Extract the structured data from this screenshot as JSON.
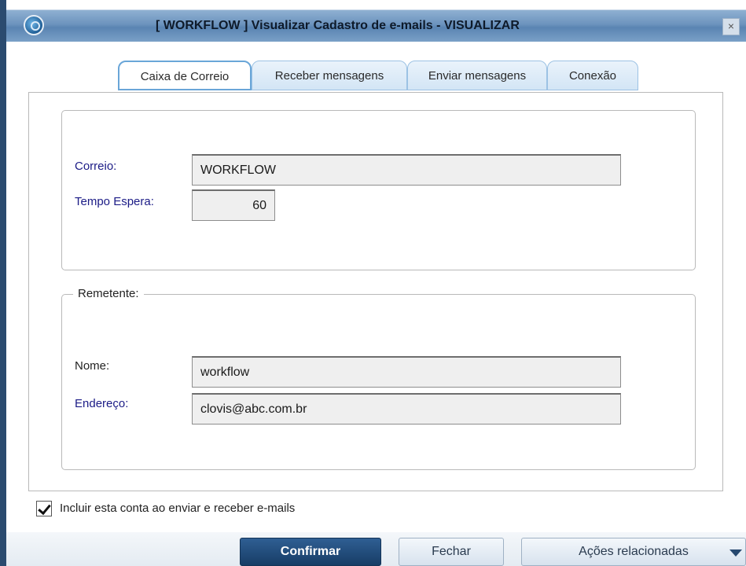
{
  "window": {
    "title": "[ WORKFLOW ] Visualizar Cadastro de e-mails - VISUALIZAR",
    "close_glyph": "×",
    "icon": "app-logo-icon"
  },
  "tabs": [
    {
      "label": "Caixa de Correio",
      "active": true
    },
    {
      "label": "Receber mensagens",
      "active": false
    },
    {
      "label": "Enviar mensagens",
      "active": false
    },
    {
      "label": "Conexão",
      "active": false
    }
  ],
  "mailbox": {
    "correio_label": "Correio:",
    "correio_value": "WORKFLOW",
    "tempo_label": "Tempo Espera:",
    "tempo_value": "60"
  },
  "sender": {
    "group_title": "Remetente:",
    "nome_label": "Nome:",
    "nome_value": "workflow",
    "endereco_label": "Endereço:",
    "endereco_value": "clovis@abc.com.br"
  },
  "options": {
    "include_account_label": "Incluir esta conta ao enviar e receber e-mails",
    "include_account_checked": true
  },
  "buttons": {
    "confirm": "Confirmar",
    "close": "Fechar",
    "related_actions": "Ações relacionadas"
  },
  "colors": {
    "titlebar": "#6c93bd",
    "primary_button": "#1f4a7a",
    "label_blue": "#1b1b86"
  }
}
